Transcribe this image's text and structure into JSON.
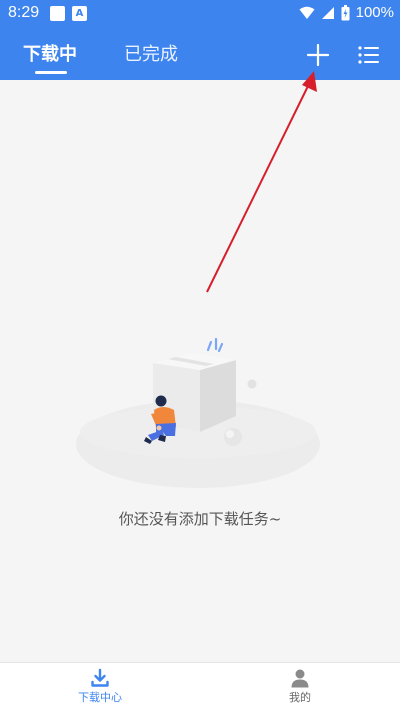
{
  "status_bar": {
    "time": "8:29",
    "battery": "100%",
    "icons": [
      "notification-square-icon",
      "app-a-icon",
      "wifi-icon",
      "signal-icon",
      "battery-icon"
    ]
  },
  "header": {
    "tabs": [
      {
        "label": "下载中",
        "active": true
      },
      {
        "label": "已完成",
        "active": false
      }
    ],
    "actions": [
      "add-icon",
      "list-menu-icon"
    ]
  },
  "empty_state": {
    "message": "你还没有添加下载任务~"
  },
  "bottom_nav": {
    "items": [
      {
        "label": "下载中心",
        "icon": "download-icon",
        "active": true
      },
      {
        "label": "我的",
        "icon": "user-icon",
        "active": false
      }
    ]
  },
  "colors": {
    "accent": "#3d84ef",
    "background": "#f5f5f5",
    "annotation_arrow": "#d61f2b"
  }
}
